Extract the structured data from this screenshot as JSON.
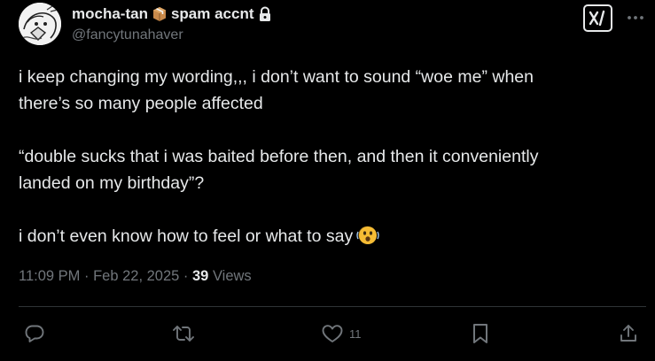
{
  "author": {
    "display_name_prefix": "mocha-tan",
    "display_name_suffix": "spam accnt",
    "display_name_emoji": "package-emoji",
    "locked_icon": "lock-icon",
    "handle": "@fancytunahaver",
    "avatar_icon": "avatar-drawing"
  },
  "header_actions": {
    "grok_icon": "grok-icon",
    "more_icon": "more-icon"
  },
  "tweet": {
    "paragraphs": [
      "i keep changing my wording,,, i don’t want to sound “woe me” when\nthere’s so many people affected",
      "“double sucks that i was baited before then, and then it conveniently\nlanded on my birthday”?",
      "i don’t even know how to feel or what to say"
    ],
    "trailing_emoji": "shaking-face-emoji"
  },
  "meta": {
    "time": "11:09 PM",
    "separator": " · ",
    "date": "Feb 22, 2025",
    "views_count": "39",
    "views_label": " Views"
  },
  "actions": {
    "reply_icon": "reply-icon",
    "repost_icon": "repost-icon",
    "like_icon": "heart-icon",
    "like_count": "11",
    "bookmark_icon": "bookmark-icon",
    "share_icon": "share-icon"
  },
  "colors": {
    "background": "#000000",
    "text_primary": "#e7e9ea",
    "text_secondary": "#71767b",
    "divider": "#2f3336"
  }
}
